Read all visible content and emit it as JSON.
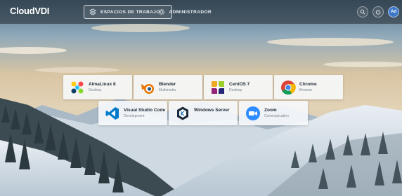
{
  "brand": {
    "logo_text": "CloudVDI"
  },
  "nav": {
    "workspaces_label": "ESPACIOS DE TRABAJO",
    "admin_label": "ADMINISTRADOR"
  },
  "header_actions": {
    "search_icon": "search-icon",
    "power_icon": "power-icon",
    "avatar_initials": "Ad"
  },
  "apps": [
    {
      "name": "AlmaLinux 8",
      "category": "Desktop",
      "icon": "almalinux-icon"
    },
    {
      "name": "Blender",
      "category": "Multimedia",
      "icon": "blender-icon"
    },
    {
      "name": "CentOS 7",
      "category": "Desktop",
      "icon": "centos-icon"
    },
    {
      "name": "Chrome",
      "category": "Browser",
      "icon": "chrome-icon"
    },
    {
      "name": "Visual Studio Code",
      "category": "Development",
      "icon": "vscode-icon"
    },
    {
      "name": "Windows Server",
      "category": "",
      "icon": "windows-server-icon"
    },
    {
      "name": "Zoom",
      "category": "Communication",
      "icon": "zoom-icon"
    }
  ],
  "colors": {
    "accent": "#3d78c8",
    "card_bg": "#f6f8fb"
  }
}
